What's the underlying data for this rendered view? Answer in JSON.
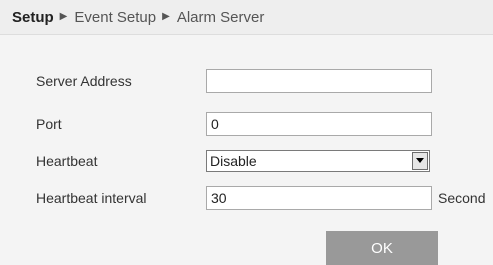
{
  "breadcrumb": {
    "items": [
      "Setup",
      "Event Setup",
      "Alarm Server"
    ],
    "separator": "▶"
  },
  "form": {
    "server_address": {
      "label": "Server Address",
      "value": ""
    },
    "port": {
      "label": "Port",
      "value": "0"
    },
    "heartbeat": {
      "label": "Heartbeat",
      "selected": "Disable"
    },
    "heartbeat_interval": {
      "label": "Heartbeat interval",
      "value": "30",
      "unit": "Second"
    }
  },
  "actions": {
    "ok_label": "OK"
  },
  "colors": {
    "breadcrumb_bg": "#eeeeee",
    "content_bg": "#f4f4f4",
    "button_bg": "#999999"
  }
}
